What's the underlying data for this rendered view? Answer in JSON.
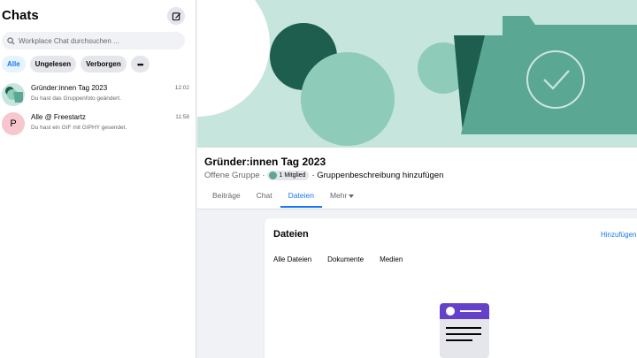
{
  "sidebar": {
    "title": "Chats",
    "search_placeholder": "Workplace Chat durchsuchen ...",
    "filters": [
      "Alle",
      "Ungelesen",
      "Verborgen"
    ],
    "chats": [
      {
        "name": "Gründer:innen Tag 2023",
        "preview": "Du hast das Gruppenfoto geändert.",
        "time": "12:02"
      },
      {
        "name": "Alle @ Freestartz",
        "preview": "Du hast ein GIF mit GIPHY gesendet.",
        "time": "11:58",
        "avatar_letter": "P"
      }
    ]
  },
  "group": {
    "title": "Gründer:innen Tag 2023",
    "type": "Offene Gruppe ·",
    "members": "1 Mitglied",
    "add_description": "· Gruppenbeschreibung hinzufügen",
    "tabs": [
      "Beiträge",
      "Chat",
      "Dateien",
      "Mehr"
    ]
  },
  "files": {
    "title": "Dateien",
    "add_label": "Hinzufügen",
    "tabs": [
      "Alle Dateien",
      "Dokumente",
      "Medien"
    ]
  },
  "colors": {
    "accent": "#1877f2",
    "cover_bg": "#c6e5dc",
    "dark_green": "#1e5e4e",
    "mid_green": "#5aa893",
    "light_green": "#8fcbb9",
    "doc_purple": "#6441c8"
  }
}
